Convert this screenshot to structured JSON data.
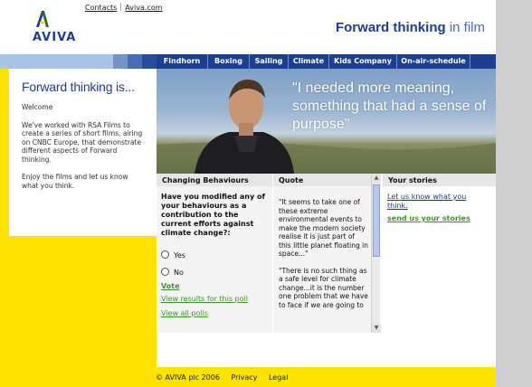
{
  "header": {
    "brand": "AVIVA",
    "links": [
      "Contacts",
      "Aviva.com"
    ],
    "tagline_bold": "Forward thinking",
    "tagline_light": "in film"
  },
  "nav": {
    "items": [
      "Findhorn",
      "Boxing",
      "Sailing",
      "Climate",
      "Kids Company",
      "On-air-schedule"
    ]
  },
  "intro": {
    "title": "Forward thinking is...",
    "welcome": "Welcome",
    "para1": "We've worked with RSA Films to create a series of short films, airing on CNBC Europe, that demonstrate different aspects of Forward thinking.",
    "para2": "Enjoy the films and let us know what you think."
  },
  "hero": {
    "quote": "\"I needed more meaning, something that had a sense of purpose\""
  },
  "poll": {
    "heading": "Changing Behaviours",
    "question": "Have you modified any of your behaviours as a contribution to the current efforts against climate change?:",
    "options": [
      "Yes",
      "No"
    ],
    "vote": "Vote",
    "view_results": "View results for this poll",
    "view_all": "View all polls"
  },
  "quote_panel": {
    "heading": "Quote",
    "q1": "\"It seems to take one of these extreme environmental events to make the modern society realise it is just part of this little planet floating in space...\"",
    "q2": "\"There is no such thing as a safe level for climate change...it is the number one problem that we have to face if we are going to"
  },
  "stories": {
    "heading": "Your stories",
    "link1": "Let us know what you think.",
    "link2": "send us your stories"
  },
  "footer": {
    "copyright": "© AVIVA plc 2006",
    "privacy": "Privacy",
    "legal": "Legal"
  },
  "colors": {
    "brand_blue": "#1c3f94",
    "yellow": "#ffe200",
    "green_link": "#3a9a2a"
  }
}
